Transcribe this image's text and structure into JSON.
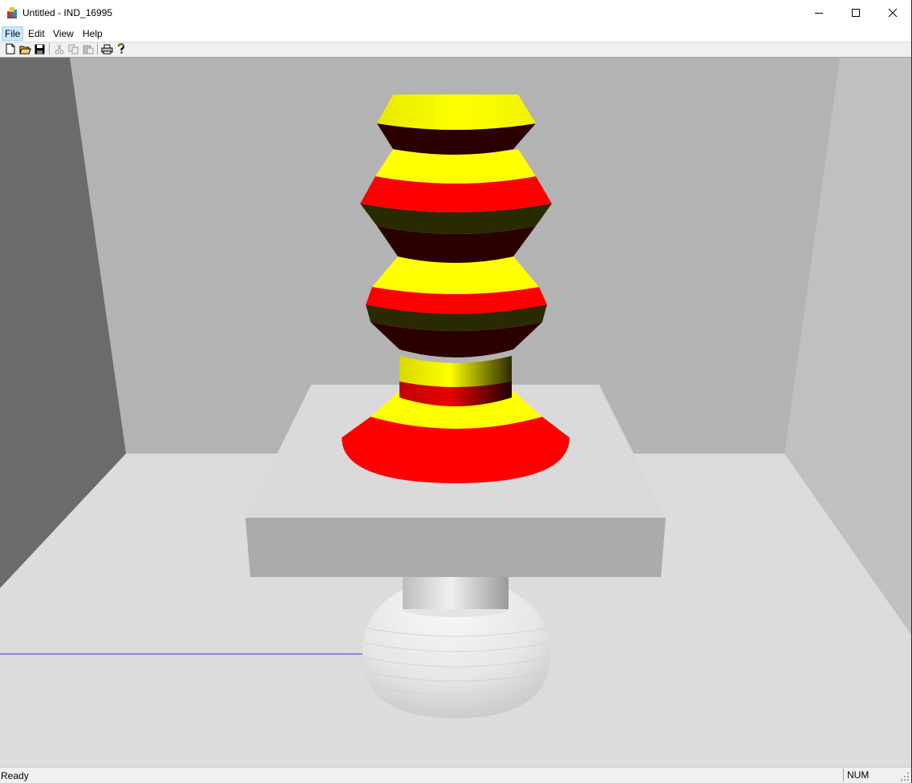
{
  "window": {
    "title": "Untitled - IND_16995",
    "minimize_icon": "minimize-icon",
    "maximize_icon": "maximize-icon",
    "close_icon": "close-icon"
  },
  "menu": {
    "items": [
      {
        "label": "File"
      },
      {
        "label": "Edit"
      },
      {
        "label": "View"
      },
      {
        "label": "Help"
      }
    ]
  },
  "toolbar": {
    "buttons": [
      {
        "icon": "new-document-icon",
        "enabled": true
      },
      {
        "icon": "open-folder-icon",
        "enabled": true
      },
      {
        "icon": "save-disk-icon",
        "enabled": true
      },
      {
        "icon": "cut-scissors-icon",
        "enabled": false
      },
      {
        "icon": "copy-icon",
        "enabled": false
      },
      {
        "icon": "paste-icon",
        "enabled": false
      },
      {
        "icon": "print-icon",
        "enabled": true
      },
      {
        "icon": "help-question-icon",
        "enabled": true
      }
    ]
  },
  "scene": {
    "colors": {
      "yellow": "#ffff00",
      "red": "#ff0000",
      "dark_olive": "#2a2a00",
      "dark_maroon": "#2a0000",
      "back_wall": "#b3b3b3",
      "side_wall_left": "#6b6b6b",
      "side_wall_right": "#c0c0c0",
      "floor": "#dcdcdc",
      "pedestal_top": "#dadada",
      "pedestal_front": "#ababab",
      "guide_line": "#3333ff"
    }
  },
  "status": {
    "text": "Ready",
    "num": "NUM"
  }
}
